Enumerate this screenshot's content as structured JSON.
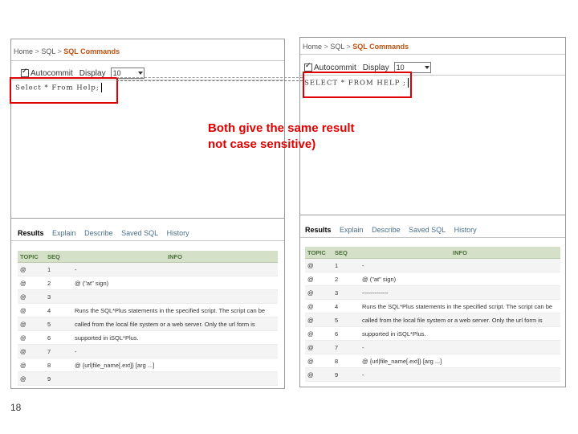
{
  "annotation": {
    "line1": "Both give the same  result",
    "line2": "not case sensitive)"
  },
  "page_number": "18",
  "colors": {
    "annotation": "#e00000",
    "crumb_current": "#c05010",
    "table_header": "#d5e0c8"
  },
  "left": {
    "breadcrumb": {
      "home": "Home",
      "sep": ">",
      "sql": "SQL",
      "current": "SQL Commands"
    },
    "autocommit_label": "Autocommit",
    "display_label": "Display",
    "display_value": "10",
    "query": "Select * From Help;",
    "tabs": {
      "results": "Results",
      "explain": "Explain",
      "describe": "Describe",
      "saved_sql": "Saved SQL",
      "history": "History"
    },
    "table": {
      "headers": {
        "topic": "TOPIC",
        "seq": "SEQ",
        "info": "INFO"
      },
      "rows": [
        {
          "topic": "@",
          "seq": "1",
          "info": "-"
        },
        {
          "topic": "@",
          "seq": "2",
          "info": "@ (\"at\" sign)"
        },
        {
          "topic": "@",
          "seq": "3",
          "info": ""
        },
        {
          "topic": "@",
          "seq": "4",
          "info": "Runs the SQL*Plus statements in the specified script. The script can be"
        },
        {
          "topic": "@",
          "seq": "5",
          "info": "called from the local file system or a web server. Only the url form is"
        },
        {
          "topic": "@",
          "seq": "6",
          "info": "supported in iSQL*Plus."
        },
        {
          "topic": "@",
          "seq": "7",
          "info": "-"
        },
        {
          "topic": "@",
          "seq": "8",
          "info": "@ {url|file_name[.ext]} [arg ...]"
        },
        {
          "topic": "@",
          "seq": "9",
          "info": ""
        }
      ]
    }
  },
  "right": {
    "breadcrumb": {
      "home": "Home",
      "sep": ">",
      "sql": "SQL",
      "current": "SQL Commands"
    },
    "autocommit_label": "Autocommit",
    "display_label": "Display",
    "display_value": "10",
    "query": "SELECT * FROM HELP ;",
    "tabs": {
      "results": "Results",
      "explain": "Explain",
      "describe": "Describe",
      "saved_sql": "Saved SQL",
      "history": "History"
    },
    "table": {
      "headers": {
        "topic": "TOPIC",
        "seq": "SEQ",
        "info": "INFO"
      },
      "rows": [
        {
          "topic": "@",
          "seq": "1",
          "info": "-"
        },
        {
          "topic": "@",
          "seq": "2",
          "info": "@ (\"at\" sign)"
        },
        {
          "topic": "@",
          "seq": "3",
          "info": "-------------"
        },
        {
          "topic": "@",
          "seq": "4",
          "info": "Runs the SQL*Plus statements in the specified script. The script can be"
        },
        {
          "topic": "@",
          "seq": "5",
          "info": "called from the local file system or a web server. Only the url form is"
        },
        {
          "topic": "@",
          "seq": "6",
          "info": "supported in iSQL*Plus."
        },
        {
          "topic": "@",
          "seq": "7",
          "info": "-"
        },
        {
          "topic": "@",
          "seq": "8",
          "info": "@ {url|file_name[.ext]} [arg ...]"
        },
        {
          "topic": "@",
          "seq": "9",
          "info": "-"
        }
      ]
    }
  }
}
